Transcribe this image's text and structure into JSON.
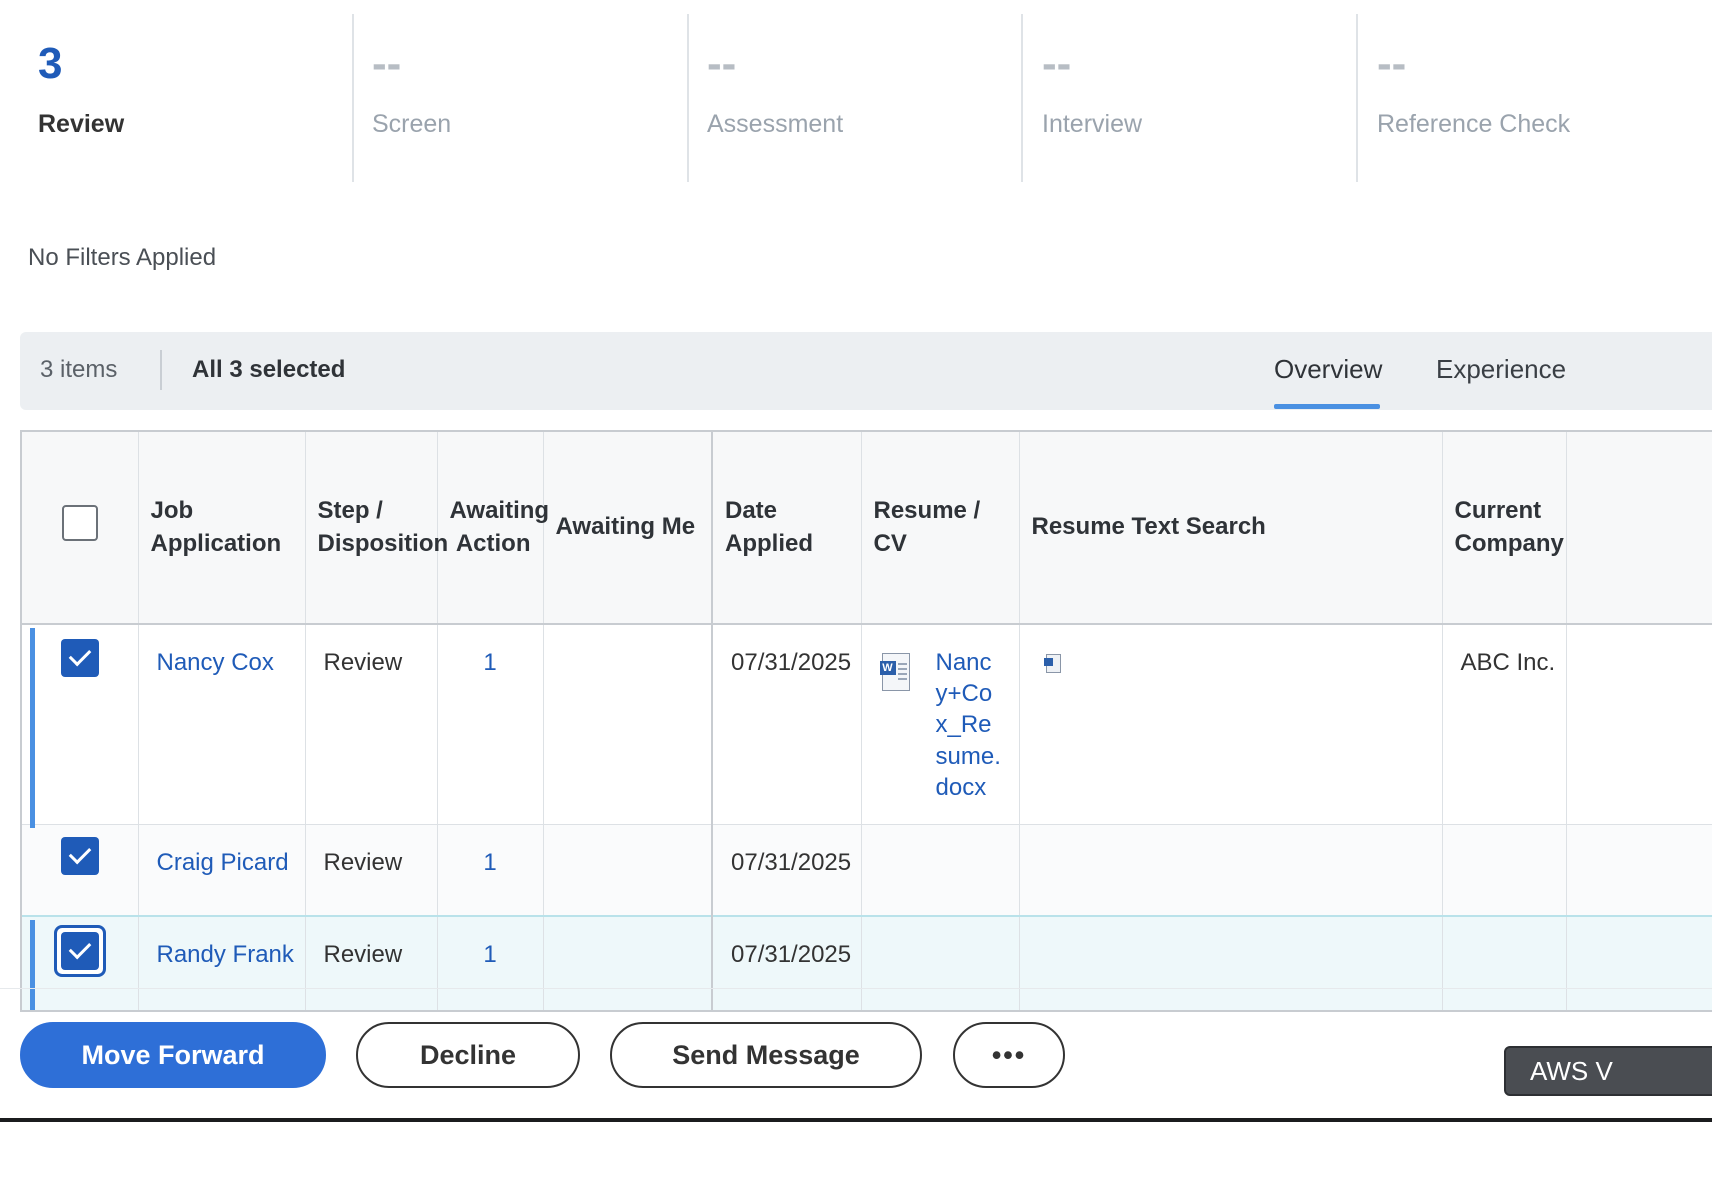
{
  "stages": [
    {
      "count": "3",
      "label": "Review"
    },
    {
      "count": "--",
      "label": "Screen"
    },
    {
      "count": "--",
      "label": "Assessment"
    },
    {
      "count": "--",
      "label": "Interview"
    },
    {
      "count": "--",
      "label": "Reference Check"
    }
  ],
  "filters_text": "No Filters Applied",
  "toolbar": {
    "items_count": "3 items",
    "selected_text": "All 3 selected",
    "tabs": [
      "Overview",
      "Experience"
    ],
    "active_tab": "Overview"
  },
  "table": {
    "headers": {
      "job_application": "Job Application",
      "step_disposition": "Step / Disposition",
      "awaiting_action": "Awaiting Action",
      "awaiting_me": "Awaiting Me",
      "date_applied": "Date Applied",
      "resume_cv": "Resume / CV",
      "resume_text_search": "Resume Text Search",
      "current_company": "Current Company"
    },
    "rows": [
      {
        "name": "Nancy Cox",
        "step": "Review",
        "awaiting_action": "1",
        "awaiting_me": "",
        "date_applied": "07/31/2025",
        "resume": "Nancy+Cox_Resume.docx",
        "current_company": "ABC Inc.",
        "selected": true
      },
      {
        "name": "Craig Picard",
        "step": "Review",
        "awaiting_action": "1",
        "awaiting_me": "",
        "date_applied": "07/31/2025",
        "resume": "",
        "current_company": "",
        "selected": true
      },
      {
        "name": "Randy Frank",
        "step": "Review",
        "awaiting_action": "1",
        "awaiting_me": "",
        "date_applied": "07/31/2025",
        "resume": "",
        "current_company": "",
        "selected": true
      }
    ]
  },
  "actions": {
    "move_forward": "Move Forward",
    "decline": "Decline",
    "send_message": "Send Message",
    "more": "•••"
  },
  "aws_widget": "AWS V",
  "icons": {
    "resume_file": "word-document-icon",
    "text_search": "document-icon"
  },
  "colors": {
    "accent": "#1f5bb8",
    "primary_button": "#2e6fd7",
    "tab_underline": "#4a90e2"
  }
}
